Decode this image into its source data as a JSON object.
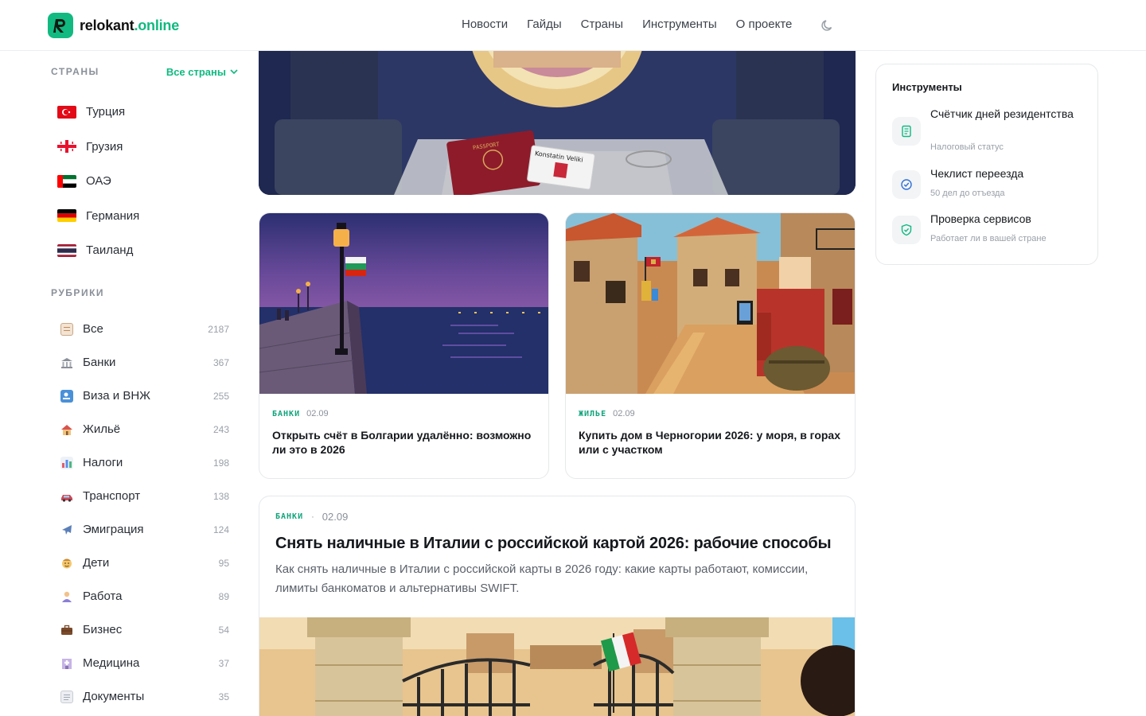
{
  "brand": {
    "name": "relokant",
    "tld": ".online",
    "color": "#10b981"
  },
  "nav": [
    "Новости",
    "Гайды",
    "Страны",
    "Инструменты",
    "О проекте"
  ],
  "theme_toggle_icon": "moon-icon",
  "sidebar": {
    "countries_title": "СТРАНЫ",
    "all_countries": "Все страны",
    "countries": [
      {
        "name": "Турция",
        "flag": "turkey-flag-icon"
      },
      {
        "name": "Грузия",
        "flag": "georgia-flag-icon"
      },
      {
        "name": "ОАЭ",
        "flag": "uae-flag-icon"
      },
      {
        "name": "Германия",
        "flag": "germany-flag-icon"
      },
      {
        "name": "Таиланд",
        "flag": "thailand-flag-icon"
      }
    ],
    "rubrics_title": "РУБРИКИ",
    "rubrics": [
      {
        "name": "Все",
        "count": "2187",
        "icon": "clipboard-icon"
      },
      {
        "name": "Банки",
        "count": "367",
        "icon": "bank-icon"
      },
      {
        "name": "Виза и ВНЖ",
        "count": "255",
        "icon": "passport-icon"
      },
      {
        "name": "Жильё",
        "count": "243",
        "icon": "house-icon"
      },
      {
        "name": "Налоги",
        "count": "198",
        "icon": "chart-icon"
      },
      {
        "name": "Транспорт",
        "count": "138",
        "icon": "car-icon"
      },
      {
        "name": "Эмиграция",
        "count": "124",
        "icon": "airplane-icon"
      },
      {
        "name": "Дети",
        "count": "95",
        "icon": "child-icon"
      },
      {
        "name": "Работа",
        "count": "89",
        "icon": "worker-icon"
      },
      {
        "name": "Бизнес",
        "count": "54",
        "icon": "briefcase-icon"
      },
      {
        "name": "Медицина",
        "count": "37",
        "icon": "hospital-icon"
      },
      {
        "name": "Документы",
        "count": "35",
        "icon": "document-icon"
      }
    ]
  },
  "cards": [
    {
      "tag": "БАНКИ",
      "date": "02.09",
      "title": "Открыть счёт в Болгарии удалённо: возможно ли это в 2026"
    },
    {
      "tag": "ЖИЛЬЕ",
      "date": "02.09",
      "title": "Купить дом в Черногории 2026: у моря, в горах или с участком"
    }
  ],
  "hero": {
    "passport_name": "Konstatin Veliki",
    "passport_label": "PASSPORT"
  },
  "wide_card": {
    "tag": "БАНКИ",
    "separator": "·",
    "date": "02.09",
    "title": "Снять наличные в Италии с российской картой 2026: рабочие способы",
    "description": "Как снять наличные в Италии с российской карты в 2026 году: какие карты работают, комиссии, лимиты банкоматов и альтернативы SWIFT."
  },
  "tools": {
    "title": "Инструменты",
    "items": [
      {
        "name": "Счётчик дней резидентства",
        "sub": "Налоговый статус",
        "icon": "document-icon"
      },
      {
        "name": "Чеклист переезда",
        "sub": "50 дел до отъезда",
        "icon": "check-circle-icon"
      },
      {
        "name": "Проверка сервисов",
        "sub": "Работает ли в вашей стране",
        "icon": "shield-check-icon"
      }
    ]
  }
}
